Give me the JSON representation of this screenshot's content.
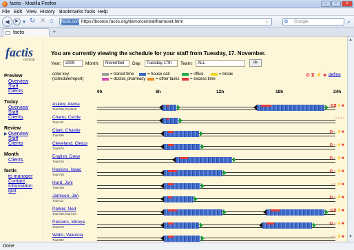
{
  "window": {
    "title": "factis - Mozilla Firefox",
    "min": "–",
    "max": "▫",
    "close": "x"
  },
  "menu": [
    "File",
    "Edit",
    "View",
    "History",
    "Bookmarks",
    "Tools",
    "Help"
  ],
  "nav": {
    "site": "factis.com",
    "url": "https://boston.factis.org/demo/central/frameset.html",
    "search_placeholder": "Google",
    "search_engine": "G"
  },
  "tab": {
    "label": "factis",
    "new_tab": "+"
  },
  "logo": {
    "word": "factis",
    "sub": "central"
  },
  "sidebar": [
    {
      "title": "Preview",
      "links": [
        "Overview",
        "Staff",
        "Clients"
      ]
    },
    {
      "title": "Today",
      "links": [
        "Overview",
        "Staff",
        "Clients"
      ]
    },
    {
      "title": "Review",
      "links": [
        "Overview",
        "Staff",
        "Clients"
      ]
    },
    {
      "title": "Month",
      "links": [
        "Clients"
      ]
    },
    {
      "title": "factis",
      "links": [
        "to manager",
        "Contact",
        "Information",
        "quit"
      ]
    }
  ],
  "heading": "You are currently viewing the schedule for your staff from Tuesday, 17. November.",
  "filters": {
    "year_label": "Year:",
    "year": "2009",
    "month_label": "Month:",
    "month": "November",
    "day_label": "Day:",
    "day": "Tuesday 17th",
    "team_label": "Team:",
    "team": "ALL",
    "ok": "ok"
  },
  "legend": {
    "title": "color key:",
    "subtitle": "(schedule/report)",
    "items": [
      {
        "label": "= transit time",
        "color": "#9a9a9a"
      },
      {
        "label": "= house call",
        "color": "#3a62c8"
      },
      {
        "label": "= office",
        "color": "#22b14c"
      },
      {
        "label": "= break",
        "color": "#f2d62a"
      },
      {
        "label": "= doctor, pharmacy",
        "color": "#d64fb3"
      },
      {
        "label": "= other tasks",
        "color": "#f08a24"
      },
      {
        "label": "= excess time",
        "color": "#e23a3a"
      }
    ]
  },
  "status_icons": "⊙ ⧖ ⚡ ♣",
  "define": "define",
  "ticks": [
    "0h",
    "6h",
    "12h",
    "18h",
    "24h"
  ],
  "staff": [
    {
      "name": "Askew, Alexia",
      "tour": "TourD05,TourN48",
      "segs": [
        [
          95,
          115
        ],
        [
          232,
          330
        ]
      ],
      "stat": "⊙⧖⚡♣"
    },
    {
      "name": "Chang, Cecile",
      "tour": "TourL62",
      "segs": [
        [
          95,
          118
        ]
      ],
      "stat": "- - - -"
    },
    {
      "name": "Clark, Chasity",
      "tour": "TourS86",
      "segs": [
        [
          97,
          148
        ]
      ],
      "stat": "⊙ - ⚡♣"
    },
    {
      "name": "Cleveland, Cletus",
      "tour": "TourB74",
      "segs": [
        [
          97,
          150
        ]
      ],
      "stat": "⊙ - ⚡♣"
    },
    {
      "name": "English, Drew",
      "tour": "TourK26",
      "segs": [
        [
          114,
          196
        ]
      ],
      "stat": "⊙ - ⚡♣"
    },
    {
      "name": "Hoskins, Isaac",
      "tour": "TourV28",
      "segs": [
        [
          97,
          182
        ]
      ],
      "stat": "⊙ - ⚡♣"
    },
    {
      "name": "Hurd, Joni",
      "tour": "TourU95",
      "segs": [
        [
          97,
          150
        ]
      ],
      "stat": "- - ⚡♣"
    },
    {
      "name": "Jamison, Jan",
      "tour": "TourA11",
      "segs": [
        [
          97,
          140
        ]
      ],
      "stat": "⊙ - ⚡♣"
    },
    {
      "name": "Parker, Ned",
      "tour": "TourX48,TourV24",
      "segs": [
        [
          97,
          182
        ],
        [
          246,
          330
        ]
      ],
      "stat": "⊙⧖⚡♣"
    },
    {
      "name": "Parsons, Mireya",
      "tour": "TourD72",
      "segs": [
        [
          97,
          148
        ],
        [
          240,
          312
        ]
      ],
      "stat": "⊙ - ⚡♣"
    },
    {
      "name": "Watts, Valencia",
      "tour": "TourS92",
      "segs": [
        [
          97,
          150
        ]
      ],
      "stat": "- - ⚡♣"
    }
  ],
  "status": "Done"
}
